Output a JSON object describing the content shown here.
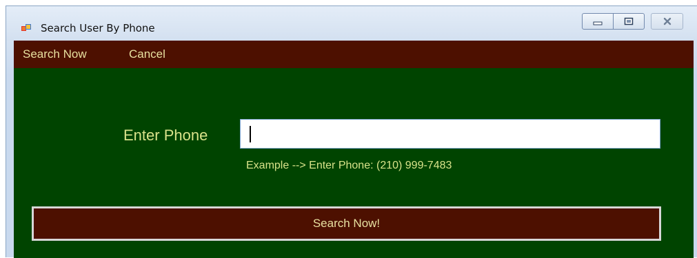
{
  "window": {
    "title": "Search User By Phone",
    "icon": "windows-form-icon"
  },
  "title_controls": {
    "minimize_icon": "minimize-icon",
    "restore_icon": "restore-icon",
    "close_icon": "close-icon"
  },
  "menu": {
    "items": [
      {
        "label": "Search Now"
      },
      {
        "label": "Cancel"
      }
    ]
  },
  "form": {
    "phone_label": "Enter Phone",
    "phone_value": "",
    "example_text": "Example --> Enter Phone:  (210) 999-7483",
    "search_button_label": "Search Now!"
  },
  "colors": {
    "menubar_bg": "#4d1000",
    "client_bg": "#004400",
    "label_text": "#d9e28a",
    "menu_text": "#e8e0a0"
  }
}
